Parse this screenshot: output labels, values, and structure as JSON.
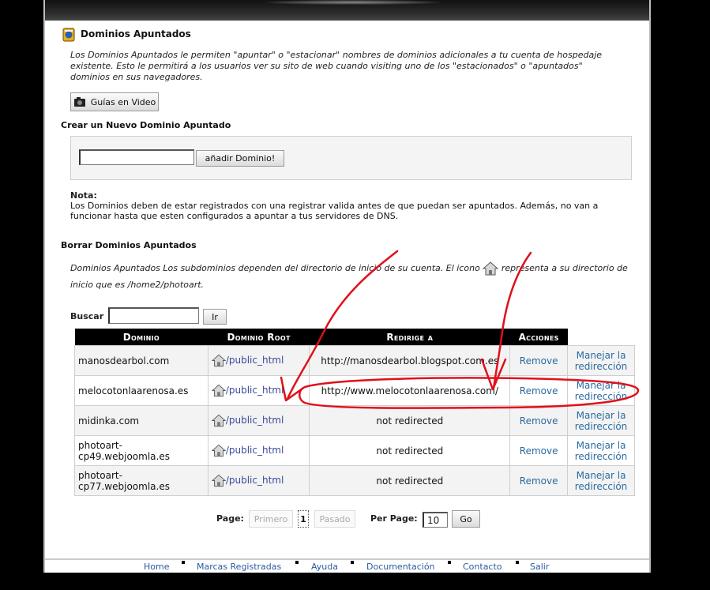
{
  "page": {
    "title": "Dominios Apuntados",
    "intro": "Los Dominios Apuntados le permiten \"apuntar\" o \"estacionar\" nombres de dominios adicionales a tu cuenta de hospedaje existente. Esto le permitirá a los usuarios ver su sito de web cuando visiting uno de los \"estacionados\" o \"apuntados\" dominios en sus navegadores.",
    "video_button": "Guías en Video"
  },
  "create": {
    "title": "Crear un Nuevo Dominio Apuntado",
    "input_value": "",
    "add_button": "añadir Dominio!"
  },
  "note": {
    "label": "Nota:",
    "text": "Los Dominios deben de estar registrados con una registrar valida antes de que puedan ser apuntados. Además, no van a funcionar hasta que esten configurados a apuntar a tus servidores de DNS."
  },
  "delete": {
    "title": "Borrar Dominios Apuntados",
    "desc_before": "Dominios Apuntados Los subdominios dependen del directorio de inicio de su cuenta. El icono",
    "desc_after": "representa a su directorio de inicio que es /home2/photoart."
  },
  "search": {
    "label": "Buscar",
    "value": "",
    "button": "Ir"
  },
  "table": {
    "headers": [
      "Dominio",
      "Dominio Root",
      "Redirige a",
      "Acciones"
    ],
    "rows": [
      {
        "domain": "manosdearbol.com",
        "root": "/public_html",
        "redirect": "http://manosdearbol.blogspot.com.es",
        "remove": "Remove",
        "manage": "Manejar la redirección"
      },
      {
        "domain": "melocotonlaarenosa.es",
        "root": "/public_html",
        "redirect": "http://www.melocotonlaarenosa.com/",
        "remove": "Remove",
        "manage": "Manejar la redirección"
      },
      {
        "domain": "midinka.com",
        "root": "/public_html",
        "redirect": "not redirected",
        "remove": "Remove",
        "manage": "Manejar la redirección"
      },
      {
        "domain": "photoart-cp49.webjoomla.es",
        "root": "/public_html",
        "redirect": "not redirected",
        "remove": "Remove",
        "manage": "Manejar la redirección"
      },
      {
        "domain": "photoart-cp77.webjoomla.es",
        "root": "/public_html",
        "redirect": "not redirected",
        "remove": "Remove",
        "manage": "Manejar la redirección"
      }
    ]
  },
  "pager": {
    "page_label": "Page:",
    "first": "Primero",
    "current": "1",
    "next": "Pasado",
    "per_page_label": "Per Page:",
    "per_page_value": "10",
    "go": "Go"
  },
  "footer": {
    "links": [
      "Home",
      "Marcas Registradas",
      "Ayuda",
      "Documentación",
      "Contacto",
      "Salir"
    ]
  },
  "colors": {
    "annotation": "#e0101a",
    "link": "#2a6aa0",
    "header_bg": "#000000"
  }
}
